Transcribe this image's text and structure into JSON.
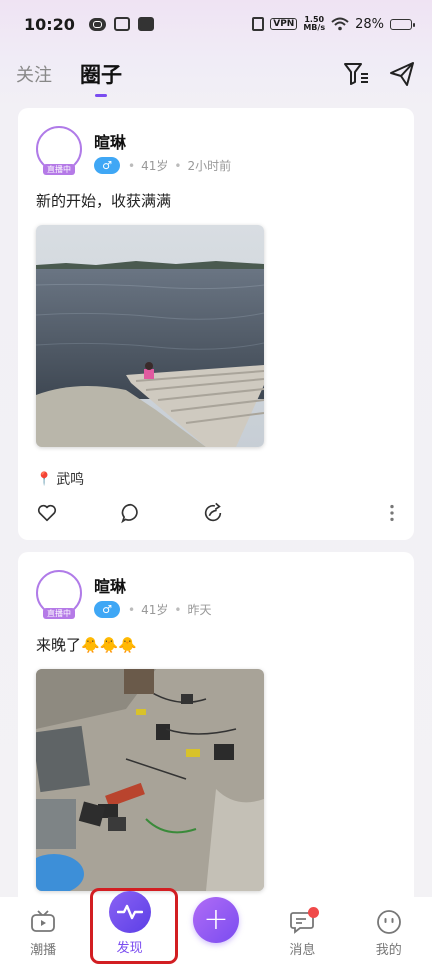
{
  "status_bar": {
    "time": "10:20",
    "vpn": "VPN",
    "net_speed_value": "1.50",
    "net_speed_unit": "MB/s",
    "battery_pct": "28%",
    "battery_level": 0.28
  },
  "top_tabs": {
    "follow": "关注",
    "circle": "圈子",
    "active": "圈子"
  },
  "posts": [
    {
      "author": "暄琳",
      "live_tag": "直播中",
      "gender_symbol": "♂",
      "age": "41岁",
      "time": "2小时前",
      "text": "新的开始，收获满满",
      "location": "武鸣"
    },
    {
      "author": "暄琳",
      "live_tag": "直播中",
      "gender_symbol": "♂",
      "age": "41岁",
      "time": "昨天",
      "text": "来晚了🐥🐥🐥"
    }
  ],
  "bottom_nav": {
    "items": [
      {
        "label": "潮播",
        "icon": "tv-icon"
      },
      {
        "label": "发现",
        "icon": "pulse-icon"
      },
      {
        "label": "",
        "icon": "plus-icon"
      },
      {
        "label": "消息",
        "icon": "chat-icon"
      },
      {
        "label": "我的",
        "icon": "face-icon"
      }
    ],
    "active": "发现"
  },
  "colors": {
    "accent": "#7a4cf0",
    "live_tag": "#b57ae7",
    "gender_badge": "#3fa7f5",
    "highlight": "#d21e22",
    "badge_dot": "#f04a4a"
  }
}
